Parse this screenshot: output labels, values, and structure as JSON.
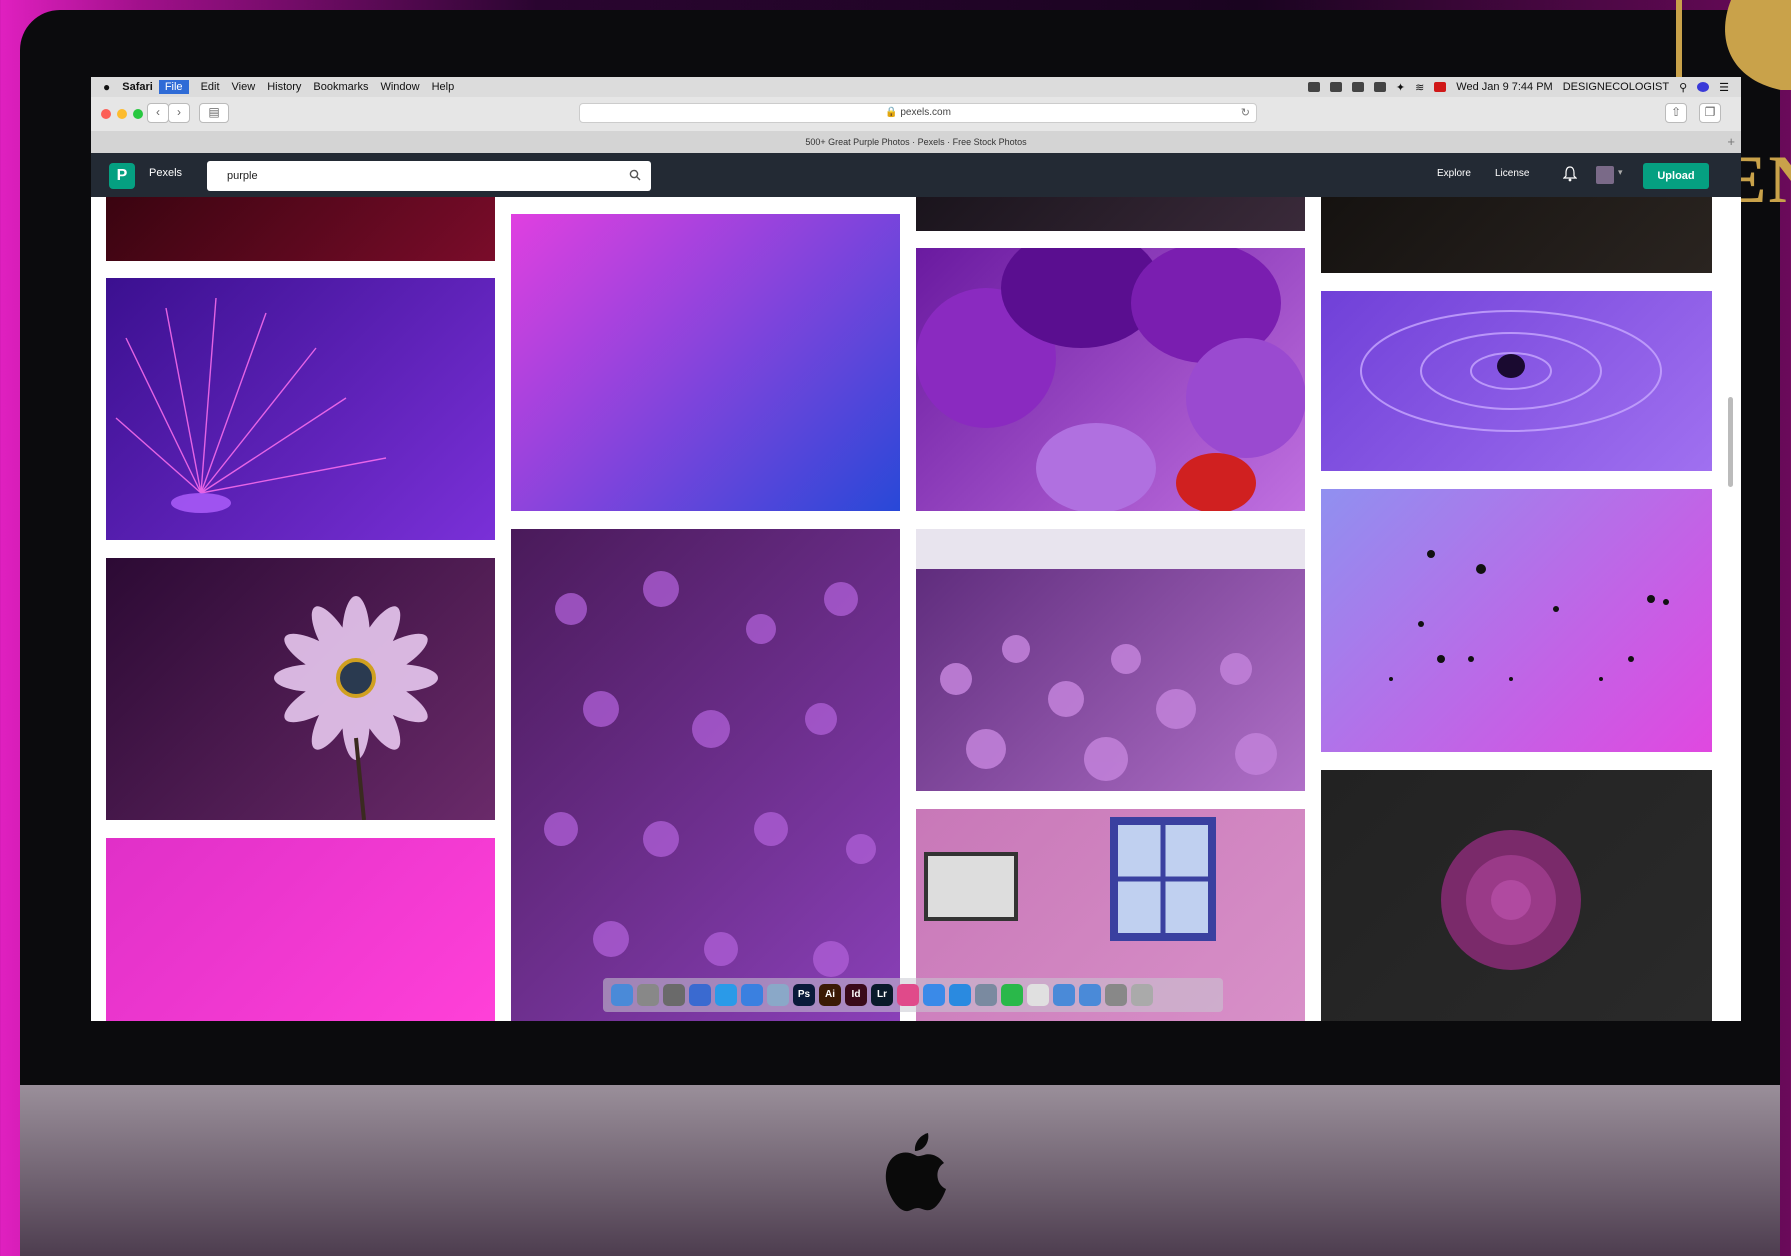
{
  "menubar": {
    "apple": "",
    "items": [
      "Safari",
      "File",
      "Edit",
      "View",
      "History",
      "Bookmarks",
      "Window",
      "Help"
    ],
    "active": "File",
    "clock": "Wed Jan 9  7:44 PM",
    "user": "DESIGNECOLOGIST"
  },
  "browser": {
    "url": "pexels.com",
    "tab_title": "500+ Great Purple Photos · Pexels · Free Stock Photos"
  },
  "pexels": {
    "brand": "Pexels",
    "search_value": "purple",
    "nav": {
      "explore": "Explore",
      "license": "License",
      "upload": "Upload"
    }
  },
  "watermark": {
    "text": "CEN"
  },
  "photos": [
    {
      "alt": "dark red bokeh lights",
      "colors": [
        "#3a0410",
        "#7a0c2a"
      ]
    },
    {
      "alt": "purple fiber optic lamp",
      "colors": [
        "#3b1090",
        "#7a30d8"
      ]
    },
    {
      "alt": "purple daisy on dark",
      "colors": [
        "#2c0a34",
        "#6a2a6a"
      ]
    },
    {
      "alt": "pink background with roses",
      "colors": [
        "#e030c8",
        "#ff40d8"
      ]
    },
    {
      "alt": "pink ink smoke",
      "colors": [
        "#e040e0",
        "#2848d8"
      ]
    },
    {
      "alt": "purple phlox flowers",
      "colors": [
        "#4a1a5a",
        "#8a40b8"
      ]
    },
    {
      "alt": "dark landscape top",
      "colors": [
        "#1a141c",
        "#3a2a3a"
      ]
    },
    {
      "alt": "purple balloons",
      "colors": [
        "#6a1aa0",
        "#c070e0"
      ]
    },
    {
      "alt": "chive flower field",
      "colors": [
        "#5a2878",
        "#b070c8"
      ]
    },
    {
      "alt": "pink house window",
      "colors": [
        "#c878b8",
        "#d890c8"
      ]
    },
    {
      "alt": "dark wood",
      "colors": [
        "#151210",
        "#2a2420"
      ]
    },
    {
      "alt": "purple water drop",
      "colors": [
        "#7040d8",
        "#a070f0"
      ]
    },
    {
      "alt": "pink sunset birds",
      "colors": [
        "#9090f0",
        "#e048e0"
      ]
    },
    {
      "alt": "purple chrysanthemum",
      "colors": [
        "#222222",
        "#2a2a2a"
      ]
    }
  ],
  "dock_apps": [
    {
      "label": "",
      "color": "#4a8ad8"
    },
    {
      "label": "",
      "color": "#888888"
    },
    {
      "label": "",
      "color": "#6a6a6a"
    },
    {
      "label": "",
      "color": "#3a6ad0"
    },
    {
      "label": "",
      "color": "#2a9ae8"
    },
    {
      "label": "",
      "color": "#3a80e0"
    },
    {
      "label": "",
      "color": "#8aa8c8"
    },
    {
      "label": "Ps",
      "color": "#0a1a3a"
    },
    {
      "label": "Ai",
      "color": "#3a1a04"
    },
    {
      "label": "Id",
      "color": "#3a0a1a"
    },
    {
      "label": "Lr",
      "color": "#0a1a2a"
    },
    {
      "label": "",
      "color": "#e04a8a"
    },
    {
      "label": "",
      "color": "#3a8ae8"
    },
    {
      "label": "",
      "color": "#2a8ae0"
    },
    {
      "label": "",
      "color": "#7a8aa0"
    },
    {
      "label": "",
      "color": "#2ab84a"
    },
    {
      "label": "",
      "color": "#e0e0e0"
    },
    {
      "label": "",
      "color": "#4a8ad8"
    },
    {
      "label": "",
      "color": "#4a8ad8"
    },
    {
      "label": "",
      "color": "#888888"
    },
    {
      "label": "",
      "color": "#aaaaaa"
    }
  ]
}
